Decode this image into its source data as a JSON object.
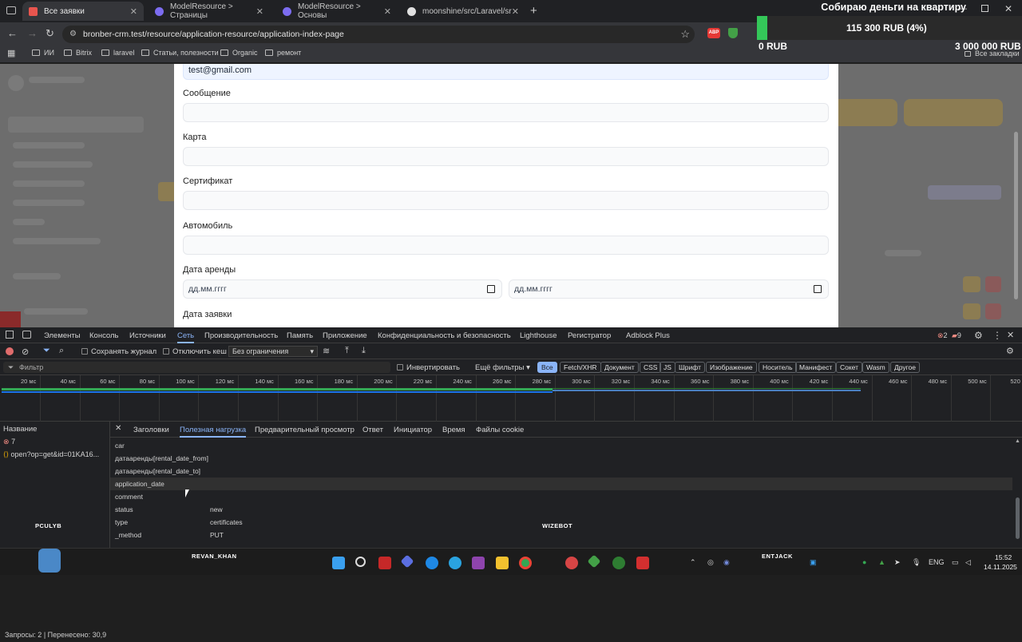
{
  "browser": {
    "tabs": [
      {
        "label": "Все заявки",
        "active": true,
        "color": "#e8554e"
      },
      {
        "label": "ModelResource > Страницы",
        "active": false,
        "color": "#7c6cf0"
      },
      {
        "label": "ModelResource > Основы",
        "active": false,
        "color": "#7c6cf0"
      },
      {
        "label": "moonshine/src/Laravel/src/Http",
        "active": false,
        "color": "#e0e0e0"
      }
    ],
    "url": "bronber-crm.test/resource/application-resource/application-index-page",
    "bookmarks": [
      "ИИ",
      "Bitrix",
      "laravel",
      "Статьи, полезности",
      "Organic",
      "ремонт"
    ],
    "all_bookmarks": "Все закладки",
    "abp_label": "ABP"
  },
  "donation": {
    "title": "Собираю деньги на квартиру",
    "amount": "115 300 RUB (4%)",
    "progress": 0.04,
    "min": "0 RUB",
    "max": "3 000 000 RUB"
  },
  "form": {
    "email_value": "test@gmail.com",
    "labels": {
      "message": "Сообщение",
      "card": "Карта",
      "certificate": "Сертификат",
      "car": "Автомобиль",
      "rental_date": "Дата аренды",
      "application_date": "Дата заявки"
    },
    "date_placeholder": "дд.мм.гггг"
  },
  "devtools": {
    "tabs": [
      "Элементы",
      "Консоль",
      "Источники",
      "Сеть",
      "Производительность",
      "Память",
      "Приложение",
      "Конфиденциальность и безопасность",
      "Lighthouse",
      "Регистратор",
      "Adblock Plus"
    ],
    "active_tab": "Сеть",
    "errors": "2",
    "warnings": "9",
    "preserve_log": "Сохранять журнал",
    "disable_cache": "Отключить кеш",
    "throttle": "Без ограничения",
    "filter_placeholder": "Фильтр",
    "invert": "Инвертировать",
    "more_filters": "Ещё фильтры",
    "type_filters": [
      "Все",
      "Fetch/XHR",
      "Документ",
      "CSS",
      "JS",
      "Шрифт",
      "Изображение",
      "Носитель",
      "Манифест",
      "Сокет",
      "Wasm",
      "Другое"
    ],
    "timeline_ticks": [
      "20 мс",
      "40 мс",
      "60 мс",
      "80 мс",
      "100 мс",
      "120 мс",
      "140 мс",
      "160 мс",
      "180 мс",
      "200 мс",
      "220 мс",
      "240 мс",
      "260 мс",
      "280 мс",
      "300 мс",
      "320 мс",
      "340 мс",
      "360 мс",
      "380 мс",
      "400 мс",
      "420 мс",
      "440 мс",
      "460 мс",
      "480 мс",
      "500 мс",
      "520"
    ],
    "name_header": "Название",
    "requests": [
      {
        "label": "7",
        "type": "error"
      },
      {
        "label": "open?op=get&id=01KA16...",
        "type": "other"
      }
    ],
    "detail_tabs": [
      "Заголовки",
      "Полезная нагрузка",
      "Предварительный просмотр",
      "Ответ",
      "Инициатор",
      "Время",
      "Файлы cookie"
    ],
    "active_detail_tab": "Полезная нагрузка",
    "payload": [
      {
        "key": "car",
        "value": ""
      },
      {
        "key": "датааренды[rental_date_from]",
        "value": ""
      },
      {
        "key": "датааренды[rental_date_to]",
        "value": ""
      },
      {
        "key": "application_date",
        "value": ""
      },
      {
        "key": "comment",
        "value": ""
      },
      {
        "key": "status",
        "value": "new"
      },
      {
        "key": "type",
        "value": "certificates"
      },
      {
        "key": "_method",
        "value": "PUT"
      }
    ],
    "status": "Запросы: 2",
    "transferred": "Перенесено: 30,9"
  },
  "stream_labels": {
    "left": "PCULYB",
    "center": "WIZEBOT",
    "bottom": "REVAN_KHAN",
    "right": "ENTJACK"
  },
  "taskbar": {
    "lang": "ENG",
    "time": "15:52",
    "date": "14.11.2025"
  }
}
